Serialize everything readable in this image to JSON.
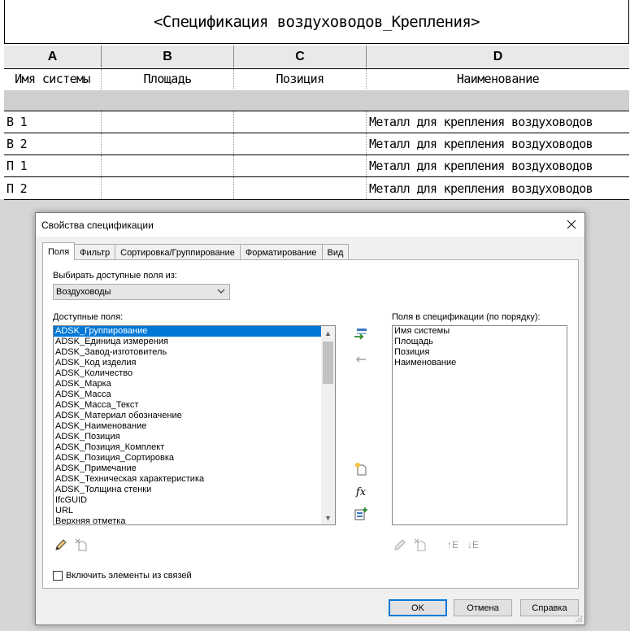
{
  "schedule": {
    "title": "<Спецификация воздуховодов_Крепления>",
    "column_letters": [
      "A",
      "B",
      "C",
      "D"
    ],
    "column_headers": [
      "Имя системы",
      "Площадь",
      "Позиция",
      "Наименование"
    ],
    "rows": [
      [
        "В 1",
        "",
        "",
        "Металл для крепления воздуховодов"
      ],
      [
        "В 2",
        "",
        "",
        "Металл для крепления воздуховодов"
      ],
      [
        "П 1",
        "",
        "",
        "Металл для крепления воздуховодов"
      ],
      [
        "П 2",
        "",
        "",
        "Металл для крепления воздуховодов"
      ]
    ]
  },
  "dialog": {
    "title": "Свойства спецификации",
    "tabs": [
      "Поля",
      "Фильтр",
      "Сортировка/Группирование",
      "Форматирование",
      "Вид"
    ],
    "select_from_label": "Выбирать доступные поля из:",
    "select_from_value": "Воздуховоды",
    "available_label": "Доступные поля:",
    "available_fields": [
      "ADSK_Группирование",
      "ADSK_Единица измерения",
      "ADSK_Завод-изготовитель",
      "ADSK_Код изделия",
      "ADSK_Количество",
      "ADSK_Марка",
      "ADSK_Масса",
      "ADSK_Масса_Текст",
      "ADSK_Материал обозначение",
      "ADSK_Наименование",
      "ADSK_Позиция",
      "ADSK_Позиция_Комплект",
      "ADSK_Позиция_Сортировка",
      "ADSK_Примечание",
      "ADSK_Техническая характеристика",
      "ADSK_Толщина стенки",
      "IfcGUID",
      "URL",
      "Верхняя отметка"
    ],
    "scheduled_label": "Поля в спецификации (по порядку):",
    "scheduled_fields": [
      "Имя системы",
      "Площадь",
      "Позиция",
      "Наименование"
    ],
    "include_links_label": "Включить элементы из связей",
    "buttons": {
      "ok": "OK",
      "cancel": "Отмена",
      "help": "Справка"
    },
    "fx_label": "fx",
    "move_up_label": "↑E",
    "move_down_label": "↓E"
  }
}
